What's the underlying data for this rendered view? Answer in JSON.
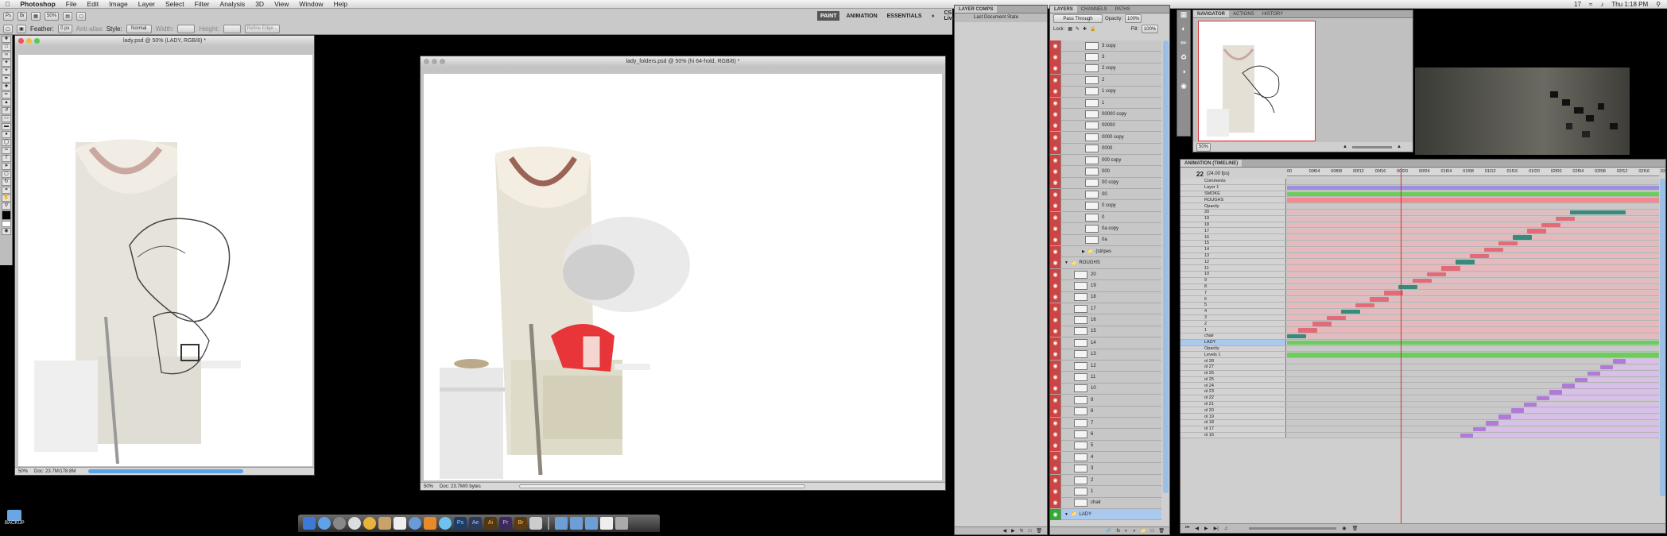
{
  "menubar": {
    "app": "Photoshop",
    "items": [
      "File",
      "Edit",
      "Image",
      "Layer",
      "Select",
      "Filter",
      "Analysis",
      "3D",
      "View",
      "Window",
      "Help"
    ],
    "status": [
      "17",
      "Thu 1:18 PM"
    ]
  },
  "options": {
    "feather": "Feather:",
    "feather_val": "0 px",
    "anti": "Anti-alias",
    "style_label": "Style:",
    "style_val": "Normal",
    "width": "Width:",
    "height": "Height:",
    "refine": "Refine Edge...",
    "zoom": "50%",
    "workspaces": [
      "PAINT",
      "ANIMATION",
      "ESSENTIALS"
    ],
    "cslive": "CS Live"
  },
  "doc1": {
    "title": "lady.psd @ 50% (LADY, RGB/8) *",
    "zoom": "50%",
    "info": "Doc: 23.7M/178.8M"
  },
  "doc2": {
    "title": "lady_folders.psd @ 50% (hi 64-hold, RGB/8) *",
    "zoom": "50%",
    "info": "Doc: 23.7M/0 bytes"
  },
  "comps": {
    "tab": "LAYER COMPS",
    "item": "Last Document State"
  },
  "layers": {
    "tabs": [
      "LAYERS",
      "CHANNELS",
      "PATHS"
    ],
    "blend": "Pass Through",
    "opacity_label": "Opacity:",
    "opacity": "100%",
    "lock": "Lock:",
    "fill_label": "Fill:",
    "fill": "100%",
    "rows": [
      "3 copy",
      "3",
      "2 copy",
      "2",
      "1 copy",
      "1",
      "00000 copy",
      "00000",
      "0000 copy",
      "0000",
      "000 copy",
      "000",
      "00 copy",
      "00",
      "0 copy",
      "0",
      "0a copy",
      "0a",
      "(stripes",
      "ROUGHS",
      "20",
      "19",
      "18",
      "17",
      "16",
      "15",
      "14",
      "13",
      "12",
      "11",
      "10",
      "9",
      "8",
      "7",
      "6",
      "5",
      "4",
      "3",
      "2",
      "1",
      "chair",
      "LADY"
    ]
  },
  "navigator": {
    "tabs": [
      "NAVIGATOR",
      "ACTIONS",
      "HISTORY"
    ],
    "zoom": "50%"
  },
  "timeline": {
    "tab": "ANIMATION (TIMELINE)",
    "frame": "22",
    "fps": "(24.00 fps)",
    "ticks": [
      "00",
      "00f04",
      "00f08",
      "00f12",
      "00f16",
      "00f20",
      "00f24",
      "01f04",
      "01f08",
      "01f12",
      "01f16",
      "01f20",
      "02f00",
      "02f04",
      "02f08",
      "02f12",
      "02f16",
      "02f20"
    ],
    "rows": [
      "Comments",
      "Layer 1",
      "SMOKE",
      "ROUGHS",
      "Opacity",
      "20",
      "19",
      "18",
      "17",
      "16",
      "15",
      "14",
      "13",
      "12",
      "11",
      "10",
      "9",
      "8",
      "7",
      "6",
      "5",
      "4",
      "3",
      "2",
      "1",
      "chair",
      "LADY",
      "Opacity",
      "Levels 1",
      "ol 28",
      "ol 27",
      "ol 26",
      "ol 25",
      "ol 24",
      "ol 23",
      "ol 22",
      "ol 21",
      "ol 20",
      "ol 19",
      "ol 18",
      "ol 17",
      "ol 16"
    ]
  },
  "desktop": {
    "folder": "BACKUP"
  },
  "colors": {
    "accent": "#c44444",
    "green": "#6ccc5c",
    "pink": "#f0a0a8",
    "purple": "#b07ad8",
    "teal": "#3a8a7a"
  }
}
